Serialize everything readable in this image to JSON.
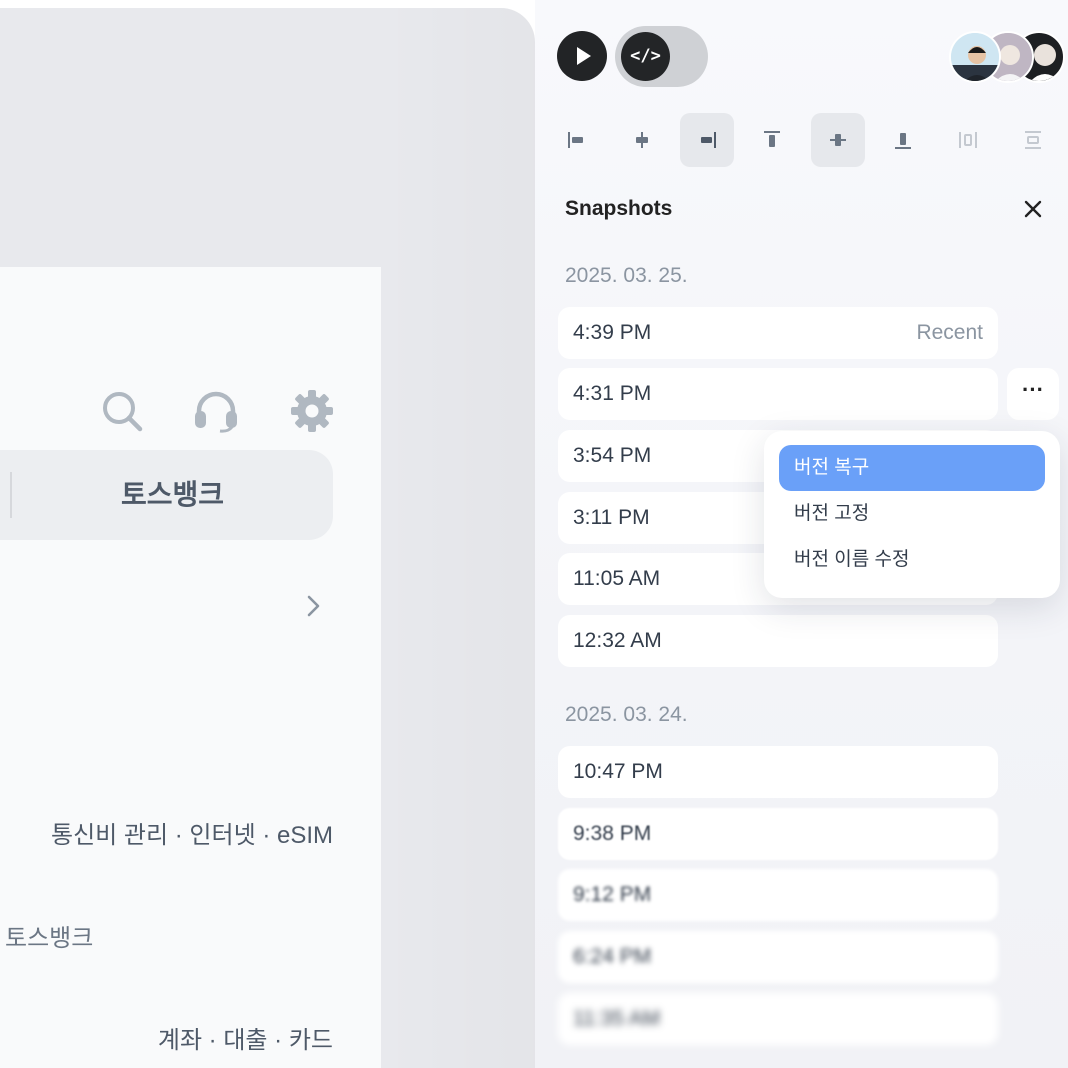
{
  "canvas": {
    "header_icons": [
      "search-icon",
      "headset-icon",
      "gear-icon"
    ],
    "bank_tab_label": "토스뱅크",
    "service_line_1": "통신비 관리 · 인터넷 · eSIM",
    "bank_caption": "토스뱅크",
    "service_line_2": "계좌 · 대출 · 카드"
  },
  "toolbar": {
    "play_icon": "play-icon",
    "code_toggle_label": "</>",
    "alignment_tools": [
      {
        "name": "align-left-icon",
        "active": false
      },
      {
        "name": "align-horizontal-center-icon",
        "active": false
      },
      {
        "name": "align-right-icon",
        "active": true
      },
      {
        "name": "align-top-icon",
        "active": false
      },
      {
        "name": "align-vertical-center-icon",
        "active": true
      },
      {
        "name": "align-bottom-icon",
        "active": false
      },
      {
        "name": "distribute-horizontal-icon",
        "active": false
      },
      {
        "name": "distribute-vertical-icon",
        "active": false
      }
    ]
  },
  "snapshots": {
    "title": "Snapshots",
    "groups": [
      {
        "date": "2025. 03. 25.",
        "items": [
          {
            "time": "4:39 PM",
            "tag": "Recent"
          },
          {
            "time": "4:31 PM"
          },
          {
            "time": "3:54 PM"
          },
          {
            "time": "3:11 PM"
          },
          {
            "time": "11:05 AM"
          },
          {
            "time": "12:32 AM"
          }
        ]
      },
      {
        "date": "2025. 03. 24.",
        "items": [
          {
            "time": "10:47 PM"
          },
          {
            "time": "9:38 PM"
          },
          {
            "time": "9:12 PM"
          },
          {
            "time": "6:24 PM"
          },
          {
            "time": "11:35 AM"
          }
        ]
      }
    ],
    "more_button_label": "···",
    "context_menu": [
      {
        "label": "버전 복구",
        "highlighted": true
      },
      {
        "label": "버전 고정",
        "highlighted": false
      },
      {
        "label": "버전 이름 수정",
        "highlighted": false
      }
    ]
  },
  "colors": {
    "accent": "#6aa0f8",
    "canvas_bg": "#e8e9ed",
    "dark_button": "#222426"
  }
}
